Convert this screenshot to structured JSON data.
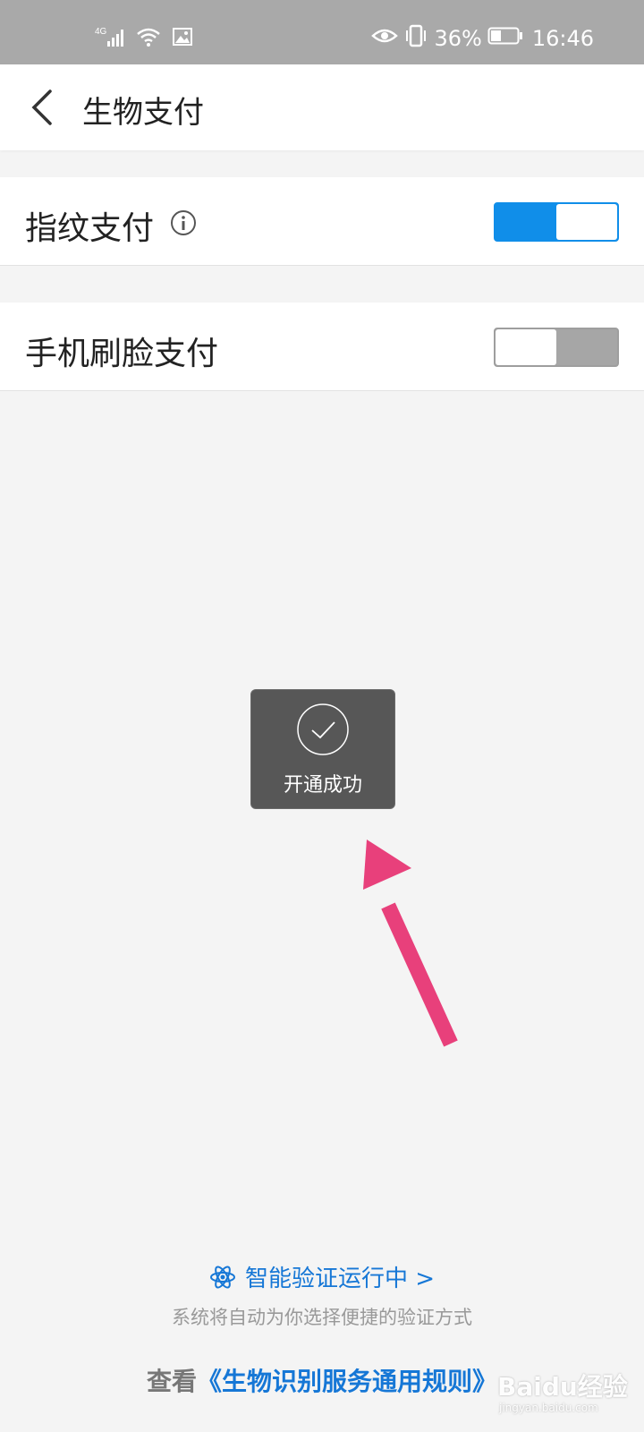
{
  "status_bar": {
    "network": "4G",
    "battery_percent": "36%",
    "time": "16:46"
  },
  "header": {
    "title": "生物支付"
  },
  "settings": {
    "fingerprint": {
      "label": "指纹支付",
      "enabled": true
    },
    "face": {
      "label": "手机刷脸支付",
      "enabled": false
    }
  },
  "toast": {
    "text": "开通成功"
  },
  "footer": {
    "smart_verify_link": "智能验证运行中 >",
    "hint": "系统将自动为你选择便捷的验证方式",
    "rules_prefix": "查看",
    "rules_link": "《生物识别服务通用规则》"
  },
  "watermark": {
    "brand": "Baidu经验",
    "url": "jingyan.baidu.com"
  },
  "colors": {
    "accent": "#108ee9",
    "link": "#1677d6",
    "annotation_arrow": "#e8407b"
  }
}
